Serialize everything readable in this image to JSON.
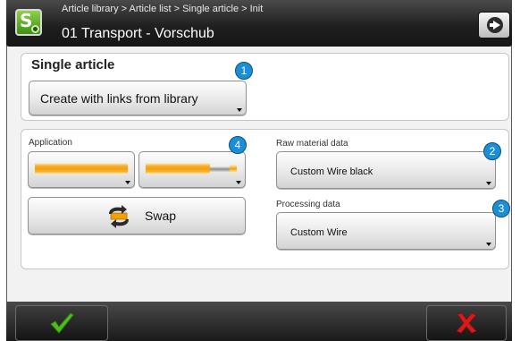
{
  "header": {
    "app_icon_letter": "S",
    "breadcrumb": "Article library > Article list > Single article > Init",
    "title": "01 Transport - Vorschub",
    "nav_icon": "arrow-right-circle-icon"
  },
  "single_article": {
    "title": "Single article",
    "create_button_label": "Create with links from library",
    "callout": "1"
  },
  "application": {
    "label": "Application",
    "wire_left_icon": "wire-full-insulation-icon",
    "wire_right_icon": "wire-stripped-end-icon",
    "callout": "4",
    "swap_button_label": "Swap",
    "swap_icon": "swap-arrows-icon"
  },
  "raw_material": {
    "label": "Raw material data",
    "value": "Custom Wire black",
    "callout": "2"
  },
  "processing": {
    "label": "Processing data",
    "value": "Custom Wire",
    "callout": "3"
  },
  "footer": {
    "ok_icon": "checkmark-icon",
    "cancel_icon": "cross-icon"
  },
  "colors": {
    "wire_orange": "#f4a000",
    "callout_blue": "#1b8fd6",
    "ok_green": "#4fbf1f",
    "cancel_red": "#d31d1d"
  }
}
